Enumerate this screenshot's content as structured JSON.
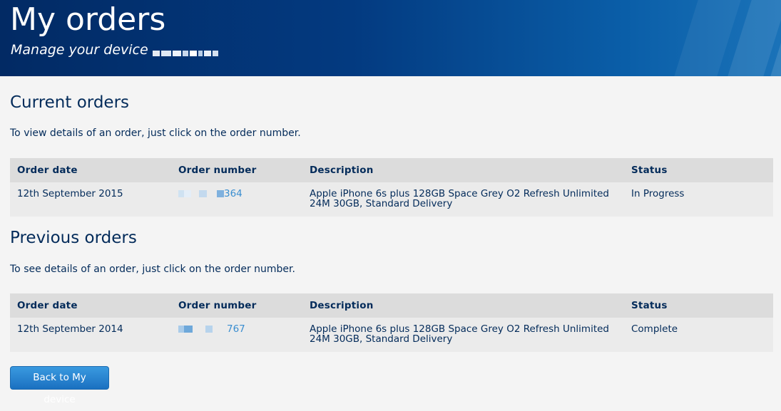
{
  "header": {
    "title": "My orders",
    "subtitle": "Manage your device"
  },
  "current_orders": {
    "title": "Current orders",
    "intro": "To view details of an order, just click on the order number.",
    "columns": [
      "Order date",
      "Order number",
      "Description",
      "Status"
    ],
    "rows": [
      {
        "date": "12th September 2015",
        "order_number_visible": "364",
        "description": "Apple iPhone 6s plus 128GB Space Grey O2 Refresh Unlimited 24M 30GB, Standard Delivery",
        "status": "In Progress"
      }
    ]
  },
  "previous_orders": {
    "title": "Previous orders",
    "intro": "To see details of an order, just click on the order number.",
    "columns": [
      "Order date",
      "Order number",
      "Description",
      "Status"
    ],
    "rows": [
      {
        "date": "12th September 2014",
        "order_number_visible": "767",
        "description": "Apple iPhone 6s plus 128GB Space Grey O2 Refresh Unlimited 24M 30GB, Standard Delivery",
        "status": "Complete"
      }
    ]
  },
  "back_button_label": "Back to My device",
  "colors": {
    "heading": "#032b5a",
    "link": "#3a8ed0",
    "header_bg": "#022a64",
    "table_header_bg": "#dcdcdc",
    "table_row_bg": "#ebebeb",
    "button_bg": "#2a86d0"
  }
}
